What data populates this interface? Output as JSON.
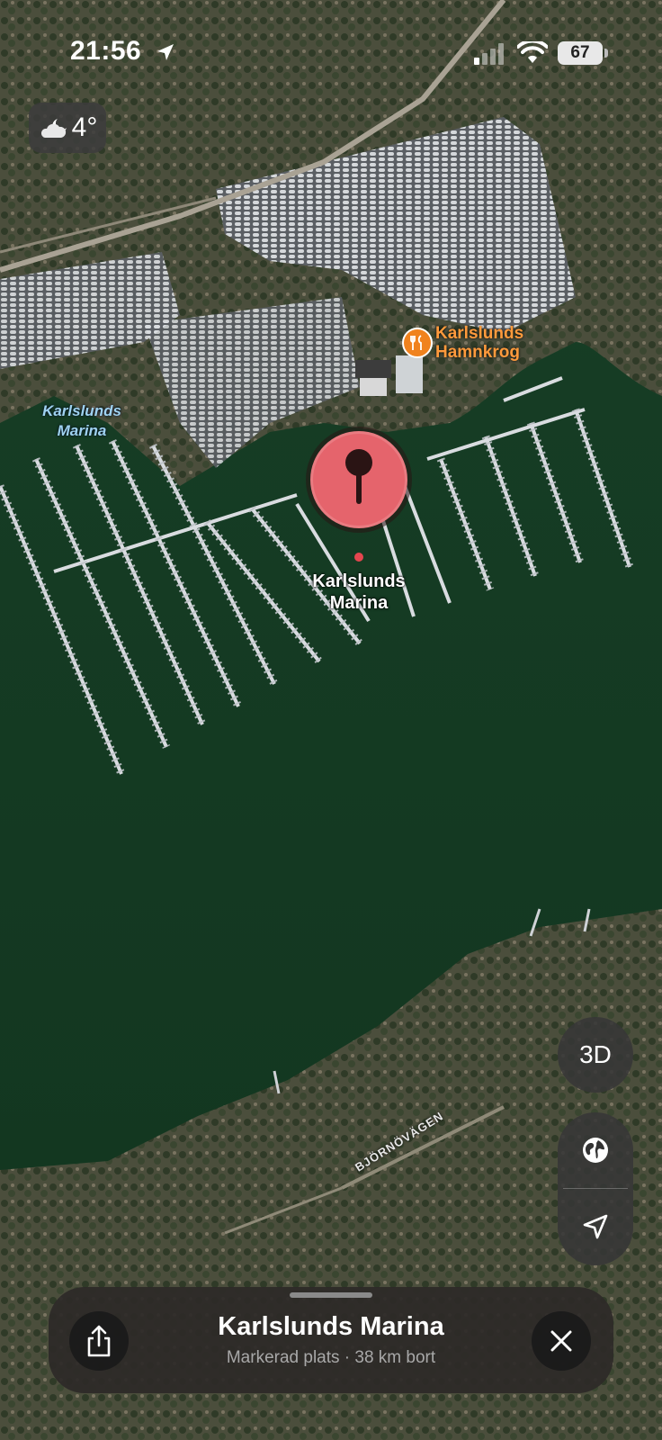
{
  "status_bar": {
    "time": "21:56",
    "battery": "67"
  },
  "weather": {
    "temperature": "4°"
  },
  "map": {
    "water_label": "Karlslunds Marina",
    "poi": {
      "name": "Karlslunds Hamnkrog",
      "icon": "fork-knife-icon",
      "color": "#f0821e"
    },
    "pin": {
      "label": "Karlslunds Marina",
      "color": "#e5646c"
    },
    "road_label": "BJÖRNÖVÄGEN"
  },
  "controls": {
    "view_3d": "3D",
    "globe": "globe-icon",
    "locate": "location-arrow-icon"
  },
  "sheet": {
    "title": "Karlslunds Marina",
    "subtitle": "Markerad plats · 38 km bort"
  }
}
